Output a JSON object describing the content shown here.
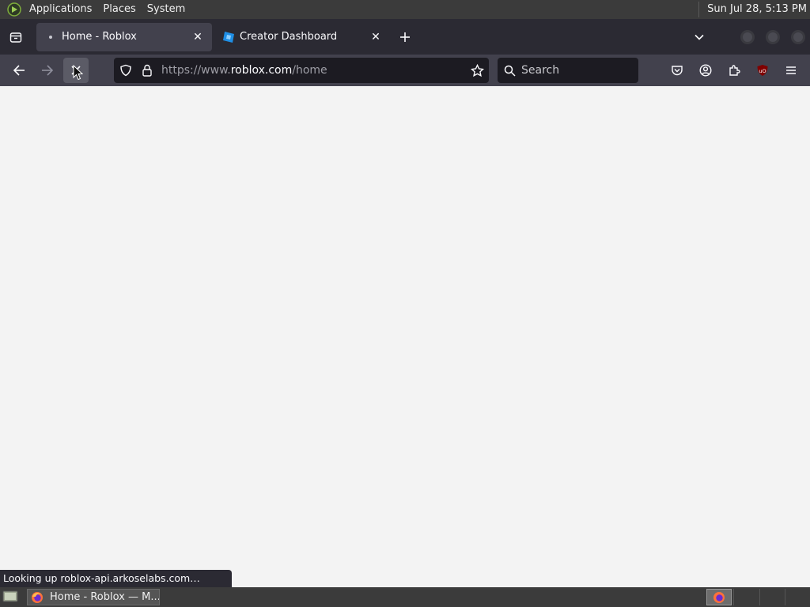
{
  "top_panel": {
    "menus": [
      "Applications",
      "Places",
      "System"
    ],
    "clock": "Sun Jul 28,  5:13 PM"
  },
  "tabs": [
    {
      "title": "Home - Roblox",
      "active": true,
      "loading": true
    },
    {
      "title": "Creator Dashboard",
      "active": false
    }
  ],
  "navbar": {
    "url_prefix": "https://www.",
    "url_domain": "roblox.com",
    "url_path": "/home",
    "search_placeholder": "Search"
  },
  "status_text": "Looking up roblox-api.arkoselabs.com…",
  "taskbar": {
    "window_title": "Home - Roblox — M..."
  },
  "colors": {
    "chrome_dark": "#2b2a33",
    "toolbar": "#42414d",
    "urlbar_bg": "#1c1b22",
    "content_bg": "#f3f3f3",
    "panel": "#3b3b3b",
    "ublock_red": "#800000"
  },
  "icons": {
    "back": "arrow-left",
    "forward": "arrow-right",
    "stop": "x-mark",
    "shield": "tracking-protection",
    "lock": "padlock",
    "bookmark": "star",
    "pocket": "pocket",
    "account": "user-circle",
    "extensions": "puzzle-piece",
    "ublock": "ublock-origin",
    "menu": "hamburger"
  }
}
